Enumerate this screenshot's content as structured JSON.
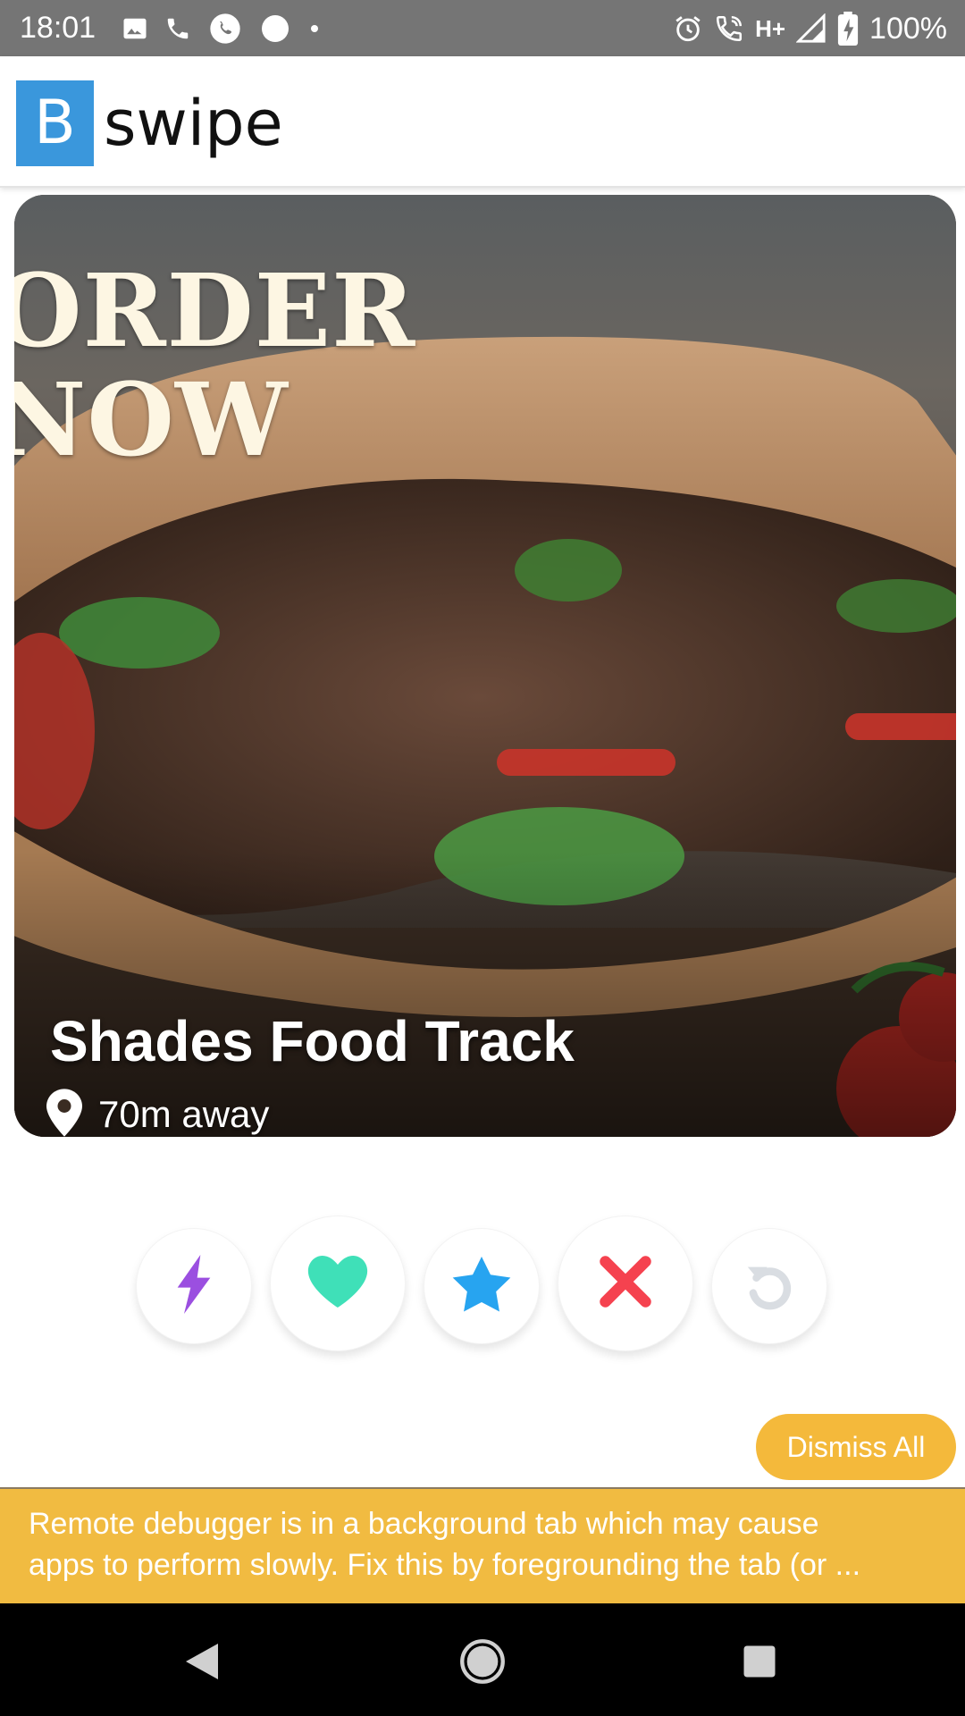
{
  "status_bar": {
    "time": "18:01",
    "network": "H+",
    "battery": "100%",
    "left_icons": [
      "image-icon",
      "phone-icon",
      "whatsapp-icon",
      "circle-icon",
      "dot-icon"
    ],
    "right_icons": [
      "alarm-icon",
      "wifi-call-icon",
      "signal-icon",
      "battery-charging-icon"
    ]
  },
  "header": {
    "logo_letter": "B",
    "app_name": "swipe"
  },
  "card": {
    "promo_line1": "ORDER",
    "promo_line2": "NOW",
    "title": "Shades Food Track",
    "distance": "70m away",
    "location_icon": "location-pin-icon"
  },
  "actions": [
    {
      "name": "boost-button",
      "icon": "lightning-icon",
      "color": "#9b4fe0"
    },
    {
      "name": "like-button",
      "icon": "heart-icon",
      "color": "#3fe0b8"
    },
    {
      "name": "superlike-button",
      "icon": "star-icon",
      "color": "#27a4f0"
    },
    {
      "name": "nope-button",
      "icon": "close-icon",
      "color": "#f5424f"
    },
    {
      "name": "rewind-button",
      "icon": "undo-icon",
      "color": "#d9dde2"
    }
  ],
  "dismiss": {
    "label": "Dismiss All"
  },
  "banner": {
    "line1": "Remote debugger is in a background tab which may cause",
    "line2": "apps to perform slowly. Fix this by foregrounding the tab (or ..."
  },
  "navbar": {
    "icons": [
      "back-icon",
      "home-icon",
      "recents-icon"
    ]
  }
}
